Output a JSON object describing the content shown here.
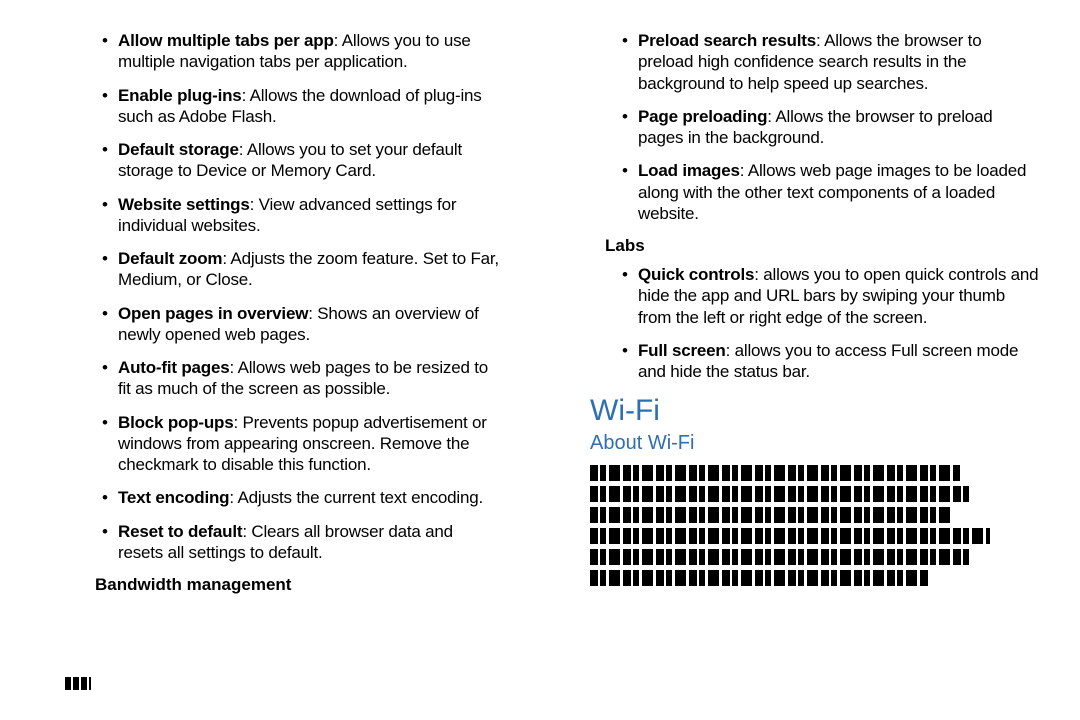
{
  "left": {
    "items": [
      {
        "bold": "Allow multiple tabs per app",
        "rest": ": Allows you to use multiple navigation tabs per application."
      },
      {
        "bold": "Enable plug-ins",
        "rest": ": Allows the download of plug-ins such as Adobe Flash."
      },
      {
        "bold": "Default storage",
        "rest": ": Allows you to set your default storage to Device or Memory Card."
      },
      {
        "bold": "Website settings",
        "rest": ": View advanced settings for individual websites."
      },
      {
        "bold": "Default zoom",
        "rest": ": Adjusts the zoom feature. Set to Far, Medium, or Close."
      },
      {
        "bold": "Open pages in overview",
        "rest": ": Shows an overview of newly opened web pages."
      },
      {
        "bold": "Auto-fit pages",
        "rest": ": Allows web pages to be resized to fit as much of the screen as possible."
      },
      {
        "bold": "Block pop-ups",
        "rest": ": Prevents popup advertisement or windows from appearing onscreen. Remove the checkmark to disable this function."
      },
      {
        "bold": "Text encoding",
        "rest": ": Adjusts the current text encoding."
      },
      {
        "bold": "Reset to default",
        "rest": ": Clears all browser data and resets all settings to default."
      }
    ],
    "bandwidth_heading": "Bandwidth management"
  },
  "right": {
    "top_items": [
      {
        "bold": "Preload search results",
        "rest": ": Allows the browser to preload high confidence search results in the background to help speed up searches."
      },
      {
        "bold": "Page preloading",
        "rest": ": Allows the browser to preload pages in the background."
      },
      {
        "bold": "Load images",
        "rest": ": Allows web page images to be loaded along with the other text components of a loaded website."
      }
    ],
    "labs_heading": "Labs",
    "labs_items": [
      {
        "bold": "Quick controls",
        "rest": ": allows you to open quick controls and hide the app and URL bars by swiping your thumb from the left or right edge of the screen."
      },
      {
        "bold": "Full screen",
        "rest": ": allows you to access Full screen mode and hide the status bar."
      }
    ],
    "wifi_heading": "Wi-Fi",
    "about_heading": "About Wi-Fi"
  },
  "redacted_widths": [
    370,
    380,
    360,
    400,
    380,
    340
  ]
}
